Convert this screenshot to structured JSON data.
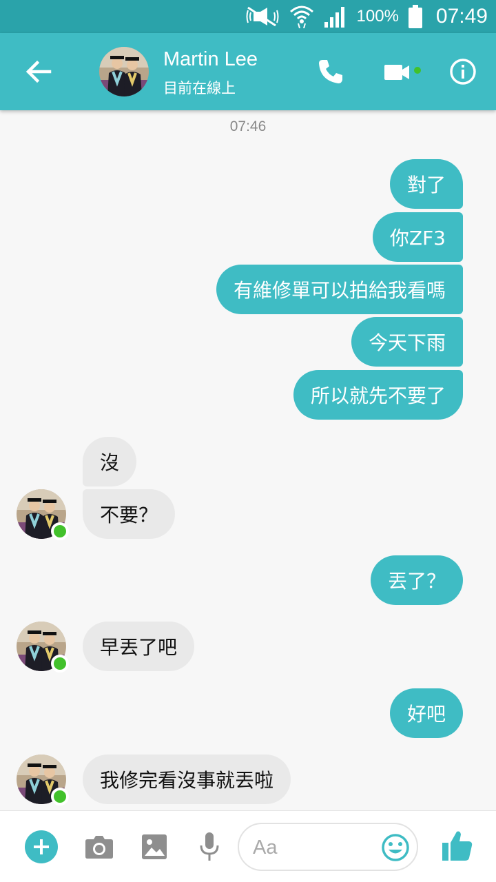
{
  "status_bar": {
    "battery": "100%",
    "time": "07:49"
  },
  "header": {
    "contact_name": "Martin Lee",
    "status": "目前在線上"
  },
  "chat": {
    "timestamp": "07:46",
    "messages": [
      {
        "side": "out",
        "text": "對了"
      },
      {
        "side": "out",
        "text": "你ZF3"
      },
      {
        "side": "out",
        "text": "有維修單可以拍給我看嗎"
      },
      {
        "side": "out",
        "text": "今天下雨"
      },
      {
        "side": "out",
        "text": "所以就先不要了"
      },
      {
        "side": "in",
        "text": "沒"
      },
      {
        "side": "in",
        "text": "不要？"
      },
      {
        "side": "out",
        "text": "丟了？"
      },
      {
        "side": "in",
        "text": "早丟了吧"
      },
      {
        "side": "out",
        "text": "好吧"
      },
      {
        "side": "in",
        "text": "我修完看沒事就丟啦"
      }
    ]
  },
  "composer": {
    "placeholder": "Aa"
  },
  "colors": {
    "status_bar": "#2aa3aa",
    "header": "#3fbcc4",
    "outgoing_bubble": "#3fbcc4",
    "incoming_bubble": "#e9e9e9",
    "online_dot": "#42c12b"
  },
  "icons": [
    "mute-icon",
    "wifi-icon",
    "signal-icon",
    "battery-icon",
    "back-arrow-icon",
    "phone-icon",
    "video-camera-icon",
    "info-icon",
    "plus-icon",
    "camera-icon",
    "image-icon",
    "microphone-icon",
    "emoji-icon",
    "thumbs-up-icon"
  ]
}
